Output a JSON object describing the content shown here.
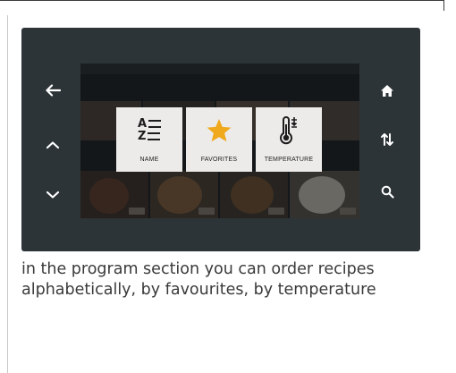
{
  "device": {
    "left_buttons": [
      {
        "icon": "arrow-left-icon"
      },
      {
        "icon": "chevron-up-icon"
      },
      {
        "icon": "chevron-down-icon"
      }
    ],
    "right_buttons": [
      {
        "icon": "home-icon"
      },
      {
        "icon": "sort-arrows-icon"
      },
      {
        "icon": "search-icon"
      }
    ]
  },
  "sort_options": [
    {
      "label": "NAME",
      "icon": "az-sort-icon"
    },
    {
      "label": "FAVORITES",
      "icon": "star-icon",
      "icon_color": "#f0a81c"
    },
    {
      "label": "TEMPERATURE",
      "icon": "thermometer-icon"
    }
  ],
  "caption": "in the program section you can order recipes alphabetically, by favourites, by temperature",
  "colors": {
    "device_body": "#2d3438",
    "star": "#f0a81c",
    "option_bg": "#ecebe9"
  }
}
